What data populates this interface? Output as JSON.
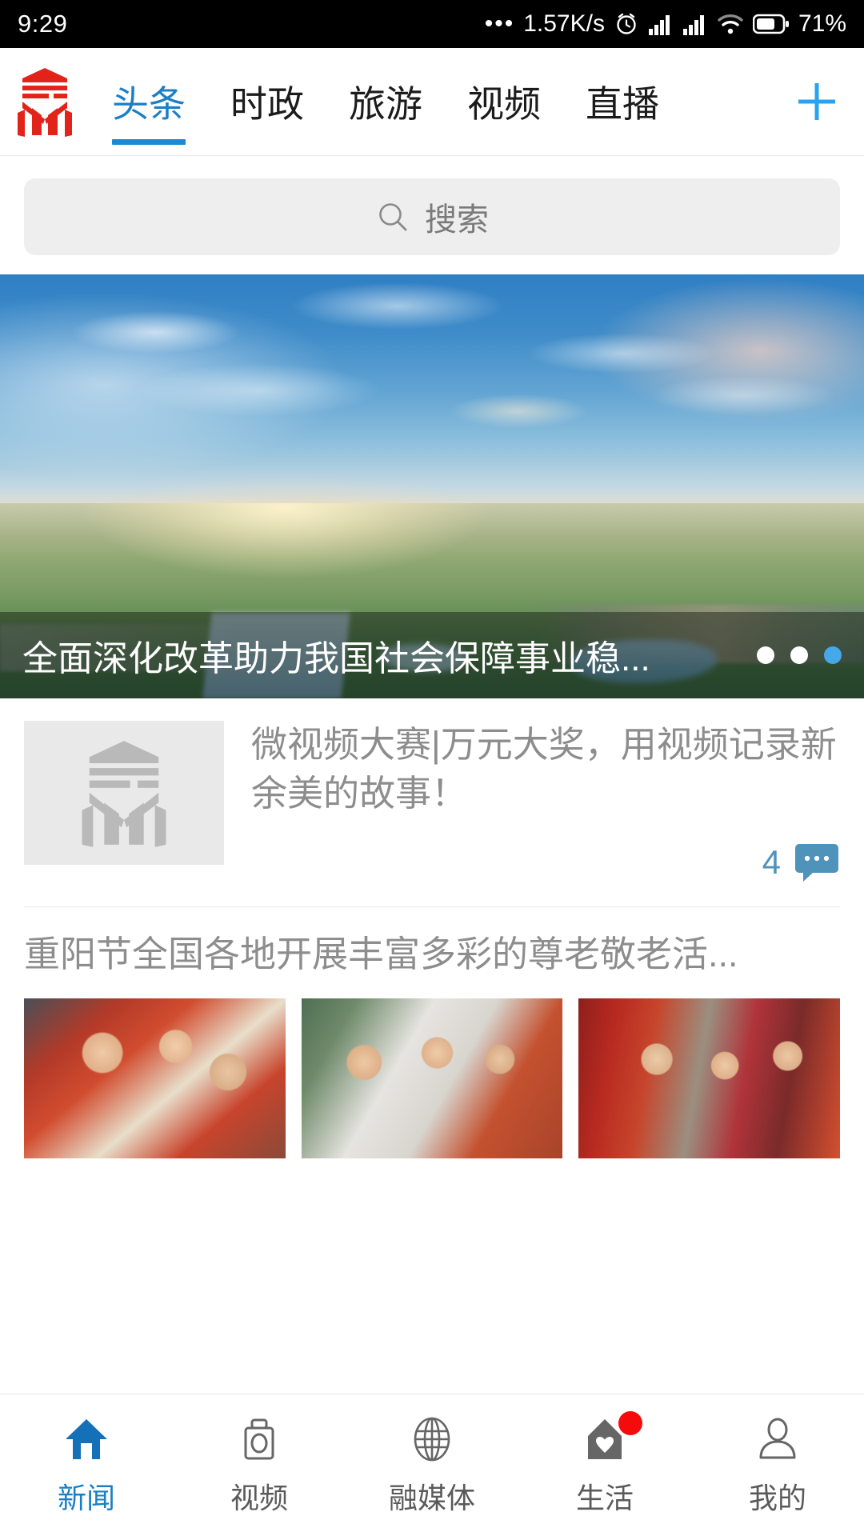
{
  "status_bar": {
    "time": "9:29",
    "overflow_dots": "•••",
    "network_speed": "1.57K/s",
    "alarm_icon": "alarm-icon",
    "signal_1_icon": "signal-bars-icon",
    "signal_2_icon": "signal-bars-icon",
    "wifi_icon": "wifi-icon",
    "battery_icon": "battery-icon",
    "battery_percent": "71%"
  },
  "top_nav": {
    "logo_icon": "app-logo-icon",
    "add_channel_label": "+",
    "tabs": [
      {
        "label": "头条",
        "active": true
      },
      {
        "label": "时政",
        "active": false
      },
      {
        "label": "旅游",
        "active": false
      },
      {
        "label": "视频",
        "active": false
      },
      {
        "label": "直播",
        "active": false
      }
    ]
  },
  "search": {
    "icon": "search-icon",
    "placeholder": "搜索",
    "value": ""
  },
  "carousel": {
    "title": "全面深化改革助力我国社会保障事业稳...",
    "dots": [
      {
        "active": false
      },
      {
        "active": false
      },
      {
        "active": true
      }
    ]
  },
  "news_list": [
    {
      "type": "thumb-left",
      "thumbnail_icon": "app-logo-placeholder-icon",
      "title": "微视频大赛|万元大奖，用视频记录新余美的故事！",
      "comment_count": "4",
      "comment_icon": "comment-bubble-icon"
    },
    {
      "type": "three-image",
      "title": "重阳节全国各地开展丰富多彩的尊老敬老活...",
      "images": [
        {
          "alt": "volunteers-making-dumplings-with-elderly"
        },
        {
          "alt": "doctors-checking-blood-pressure-for-elderly"
        },
        {
          "alt": "elderly-couples-under-rose-arch"
        }
      ]
    }
  ],
  "bottom_nav": [
    {
      "label": "新闻",
      "icon": "home-icon",
      "active": true,
      "badge": false
    },
    {
      "label": "视频",
      "icon": "camera-icon",
      "active": false,
      "badge": false
    },
    {
      "label": "融媒体",
      "icon": "globe-icon",
      "active": false,
      "badge": false
    },
    {
      "label": "生活",
      "icon": "house-heart-icon",
      "active": false,
      "badge": true
    },
    {
      "label": "我的",
      "icon": "person-icon",
      "active": false,
      "badge": false
    }
  ],
  "colors": {
    "accent_blue": "#1a7fc4",
    "tab_underline": "#1a8ad4",
    "logo_red": "#e2231a",
    "comment_blue": "#4f93bb",
    "badge_red": "#f50b0b",
    "search_bg": "#eeeeee",
    "muted_text": "#8d8d8d"
  }
}
